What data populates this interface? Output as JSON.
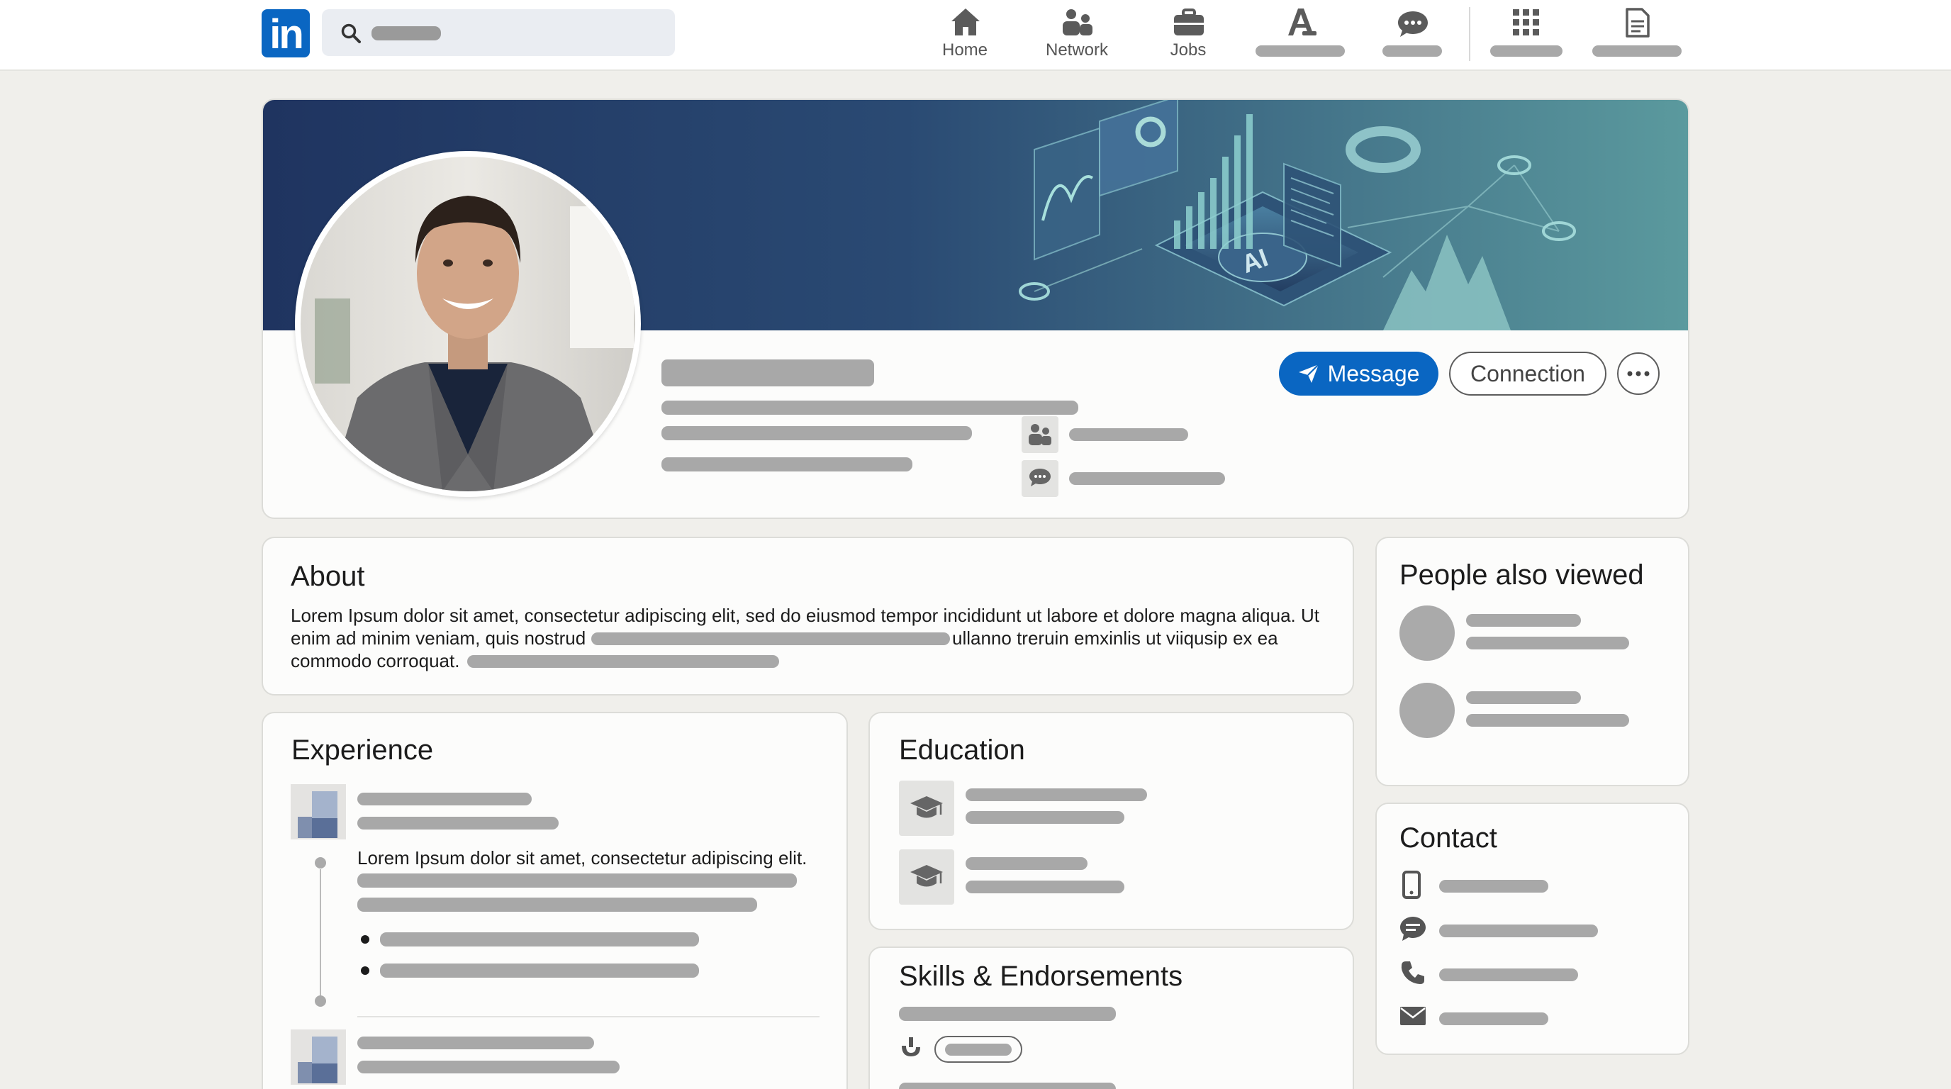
{
  "nav": {
    "items": [
      {
        "label": "Home",
        "icon": "home-icon"
      },
      {
        "label": "Network",
        "icon": "network-icon"
      },
      {
        "label": "Jobs",
        "icon": "briefcase-icon"
      }
    ]
  },
  "profile": {
    "message_label": "Message",
    "connection_label": "Connection"
  },
  "about": {
    "title": "About",
    "line1": "Lorem Ipsum dolor sit amet, consectetur adipiscing elit, sed do eiusmod tempor incididunt ut labore et dolore magna aliqua. Ut",
    "line2a": "enim ad minim veniam, quis nostrud",
    "line2b": "ullanno treruin emxinlis ut viiqusip ex ea",
    "line3": "commodo corroquat."
  },
  "experience": {
    "title": "Experience",
    "description": "Lorem Ipsum dolor sit amet, consectetur adipiscing elit."
  },
  "education": {
    "title": "Education"
  },
  "skills": {
    "title": "Skills & Endorsements"
  },
  "people": {
    "title": "People also viewed"
  },
  "contact": {
    "title": "Contact"
  },
  "colors": {
    "brand": "#0a66c2",
    "placeholder": "#a8a8a8"
  }
}
